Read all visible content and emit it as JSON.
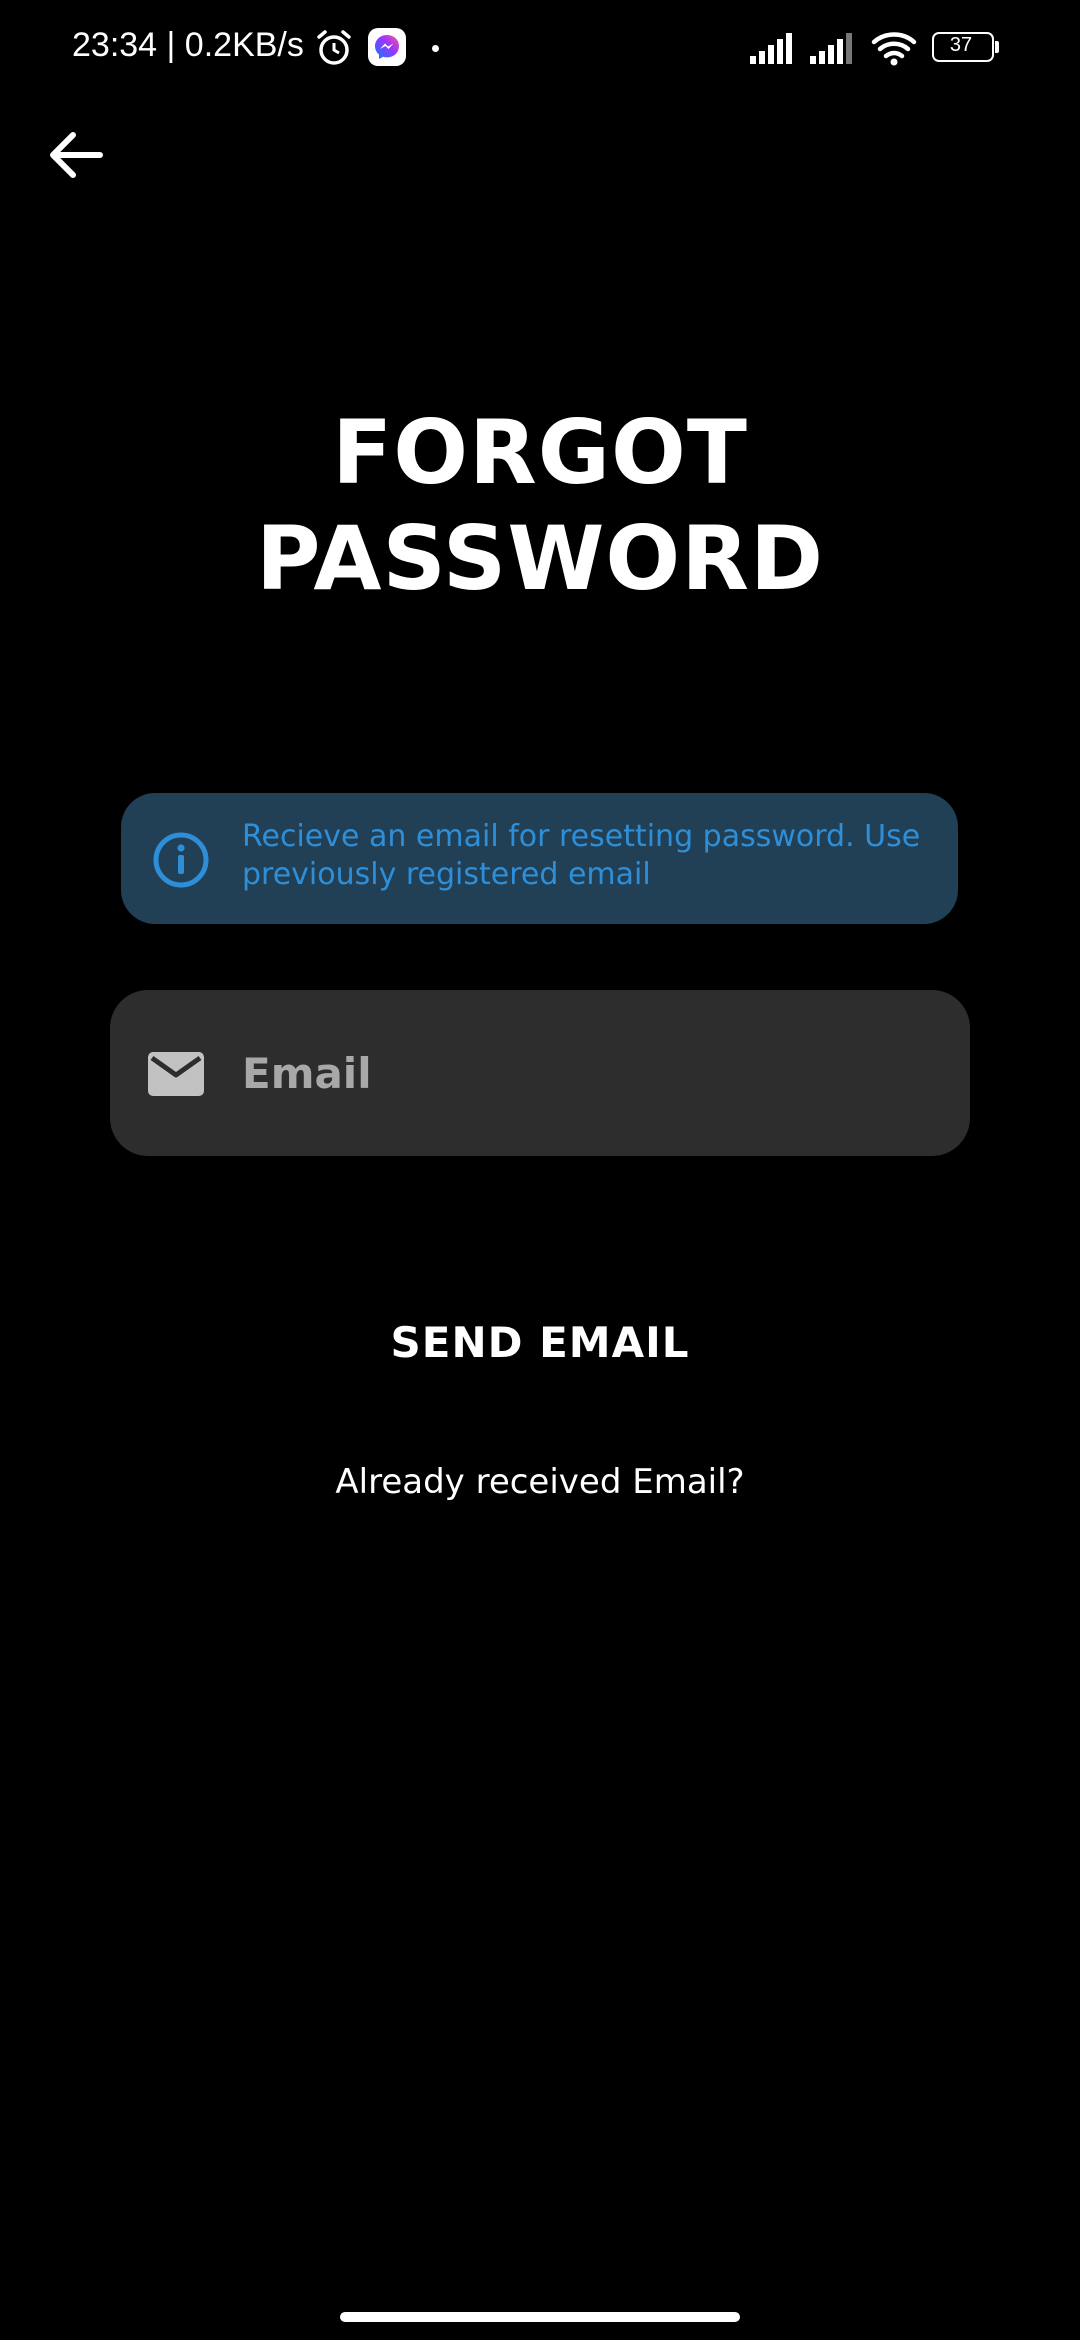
{
  "status_bar": {
    "time_speed": "23:34 | 0.2KB/s",
    "battery_level": "37",
    "icons": [
      "alarm-icon",
      "messenger-icon",
      "dot-icon",
      "signal-icon",
      "signal-icon",
      "wifi-icon",
      "battery-icon"
    ]
  },
  "nav": {
    "back_icon": "arrow-left-icon"
  },
  "page": {
    "title_line1": "FORGOT",
    "title_line2": "PASSWORD"
  },
  "info_banner": {
    "icon": "info-icon",
    "text": "Recieve an email for resetting password. Use previously registered email",
    "background_color": "#213f55",
    "text_color": "#2e8fd8"
  },
  "email_field": {
    "icon": "mail-icon",
    "placeholder": "Email",
    "value": ""
  },
  "actions": {
    "send_label": "SEND EMAIL",
    "already_received_label": "Already received Email?"
  },
  "colors": {
    "background": "#000000",
    "field_background": "#2d2d2d",
    "text": "#ffffff"
  }
}
